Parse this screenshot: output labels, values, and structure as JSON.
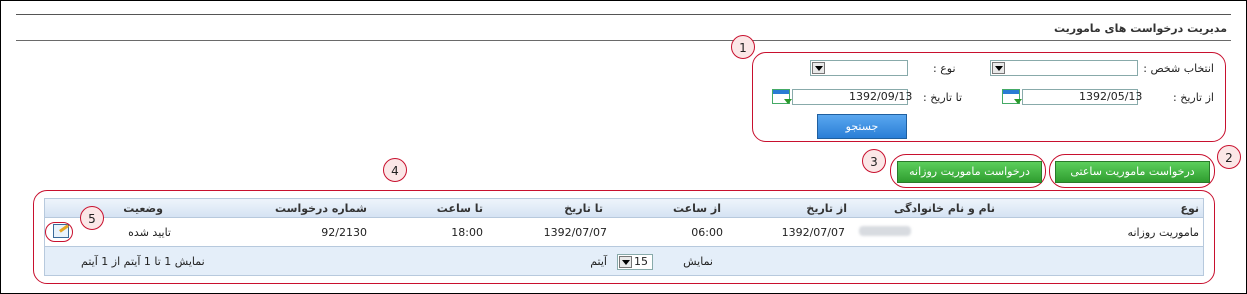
{
  "page": {
    "title": "مدیریت درخواست های ماموریت"
  },
  "filters": {
    "person_label": "انتخاب شخص :",
    "type_label": "نوع :",
    "from_date_label": "از تاریخ :",
    "from_date_value": "1392/05/13",
    "to_date_label": "تا تاریخ :",
    "to_date_value": "1392/09/13",
    "search_button": "جستجو"
  },
  "actions": {
    "hourly_mission_button": "درخواست ماموریت ساعتی",
    "daily_mission_button": "درخواست ماموریت روزانه"
  },
  "table": {
    "columns": [
      "نوع",
      "نام و نام خانوادگی",
      "از تاریخ",
      "از ساعت",
      "تا تاریخ",
      "تا ساعت",
      "شماره درخواست",
      "وضعیت"
    ],
    "rows": [
      {
        "type": "ماموریت روزانه",
        "from_date": "1392/07/07",
        "from_time": "06:00",
        "to_date": "1392/07/07",
        "to_time": "18:00",
        "request_no": "92/2130",
        "status": "تایید شده"
      }
    ],
    "pager": {
      "show_label": "نمایش",
      "page_size": "15",
      "items_label": "آیتم",
      "summary": "نمایش 1 تا 1 آیتم از 1 آیتم"
    }
  },
  "callouts": [
    "1",
    "2",
    "3",
    "4",
    "5"
  ],
  "colors": {
    "callout_red": "#c8102e",
    "search_blue": "#2a7ed6",
    "action_green": "#2f9d2f"
  }
}
